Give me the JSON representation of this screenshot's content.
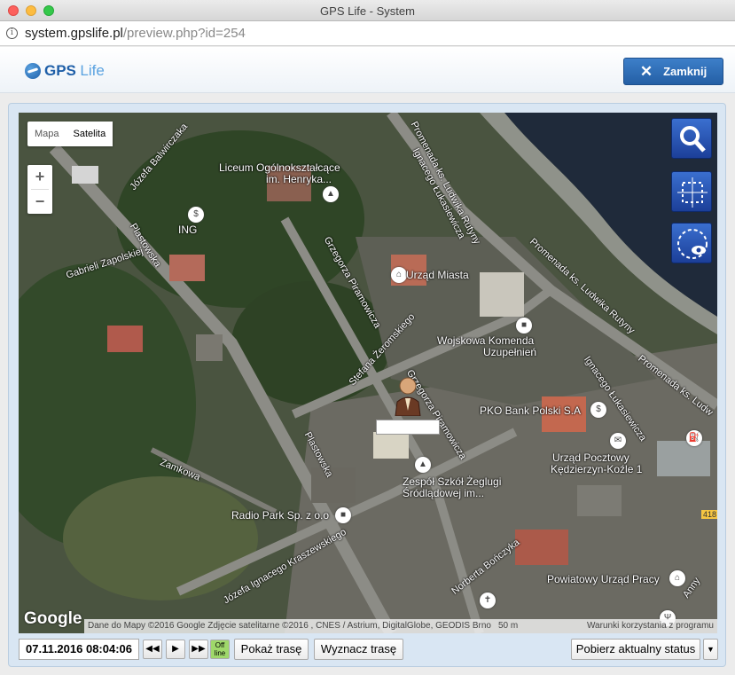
{
  "window": {
    "title": "GPS Life - System"
  },
  "browser": {
    "url_host": "system.gpslife.pl",
    "url_path": "/preview.php?id=254"
  },
  "header": {
    "logo_gps": "GPS",
    "logo_life": "Life",
    "close_label": "Zamknij"
  },
  "map": {
    "type_buttons": [
      "Mapa",
      "Satelita"
    ],
    "selected_type": "Satelita",
    "zoom_in": "+",
    "zoom_out": "−",
    "labels": {
      "liceum": "Liceum Ogólnokształcące",
      "liceum2": "im. Henryka...",
      "ing": "ING",
      "urzad_miasta": "Urząd Miasta",
      "wojskowa": "Wojskowa Komenda",
      "wojskowa2": "Uzupełnień",
      "pko": "PKO Bank Polski S.A",
      "poczta": "Urząd Pocztowy",
      "poczta2": "Kędzierzyn-Koźle 1",
      "zespol": "Zespół Szkół Żeglugi",
      "zespol2": "Śródlądowej im...",
      "radio": "Radio Park Sp. z o.o",
      "powiat": "Powiatowy Urząd Pracy"
    },
    "streets": {
      "balwircz": "Józefa Balwirczaka",
      "plast1": "Plastowska",
      "zapol": "Gabrieli Zapolskiej",
      "promenada1": "Promenada ks. Ludwika Rutyny",
      "ignac1": "Ignacego Łukasiewicza",
      "grzeg1": "Grzegorza Piramowicza",
      "zerom": "Stefana Żeromskiego",
      "grzeg2": "Grzegorza Piramowicza",
      "promenada2": "Promenada ks. Ludwika Rutyny",
      "ignac2": "Ignacego Łukasiewicza",
      "promenada3": "Promenada ks. Ludw",
      "plast2": "Plastowska",
      "zamkowa": "Zamkowa",
      "kraszew": "Józefa Ignacego Kraszewskiego",
      "bonczyk": "Norberta Bończyka",
      "anny": "Anny",
      "road": "418",
      "ulica": "Jana Pawła II"
    },
    "google": "Google",
    "attribution": "Dane do Mapy ©2016 Google Zdjęcie satelitarne ©2016 , CNES / Astrium, DigitalGlobe, GEODIS Brno",
    "scale": "50 m",
    "terms": "Warunki korzystania z programu"
  },
  "controls": {
    "datetime": "07.11.2016 08:04:06",
    "prev": "◀◀",
    "play": "▶",
    "next": "▶▶",
    "offline_top": "Off",
    "offline_bottom": "line",
    "show_route": "Pokaż trasę",
    "plan_route": "Wyznacz trasę",
    "get_status": "Pobierz aktualny status",
    "dropdown": "▼"
  }
}
